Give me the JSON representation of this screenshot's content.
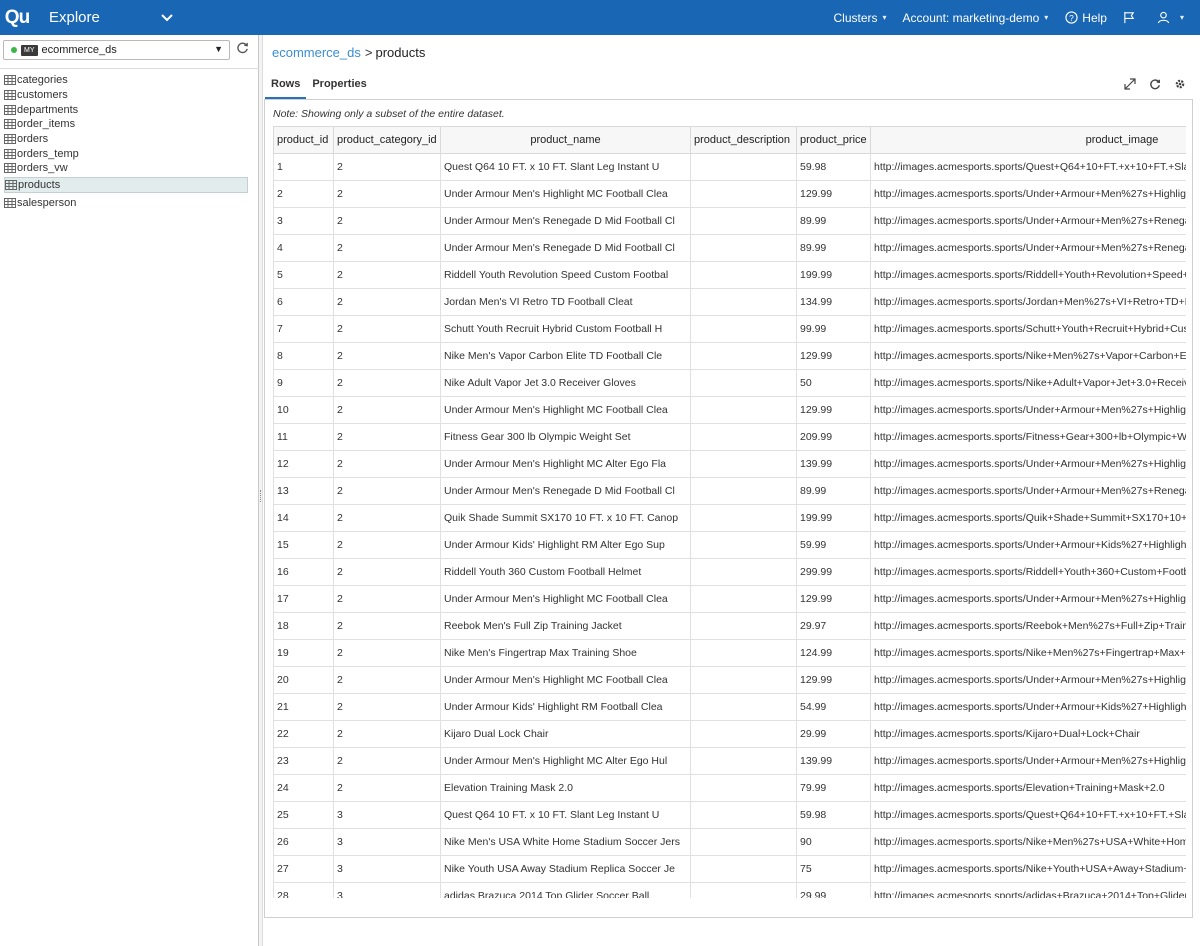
{
  "app": {
    "logo": "Qu",
    "title": "Explore",
    "clusters_label": "Clusters",
    "account_label": "Account: marketing-demo",
    "help_label": "Help"
  },
  "sidebar": {
    "datasource": {
      "badge": "MY",
      "name": "ecommerce_ds"
    },
    "tables": [
      {
        "name": "categories"
      },
      {
        "name": "customers"
      },
      {
        "name": "departments"
      },
      {
        "name": "order_items"
      },
      {
        "name": "orders"
      },
      {
        "name": "orders_temp"
      },
      {
        "name": "orders_vw"
      },
      {
        "name": "products",
        "selected": true
      },
      {
        "name": "salesperson"
      }
    ]
  },
  "breadcrumb": {
    "datasource": "ecommerce_ds",
    "separator": ">",
    "table": "products"
  },
  "tabs": [
    {
      "label": "Rows",
      "active": true
    },
    {
      "label": "Properties",
      "active": false
    }
  ],
  "note": "Note: Showing only a subset of the entire dataset.",
  "grid": {
    "columns": [
      "product_id",
      "product_category_id",
      "product_name",
      "product_description",
      "product_price",
      "product_image"
    ],
    "rows": [
      [
        "1",
        "2",
        "Quest Q64 10 FT. x 10 FT. Slant Leg Instant U",
        "",
        "59.98",
        "http://images.acmesports.sports/Quest+Q64+10+FT.+x+10+FT.+Sla"
      ],
      [
        "2",
        "2",
        "Under Armour Men's Highlight MC Football Clea",
        "",
        "129.99",
        "http://images.acmesports.sports/Under+Armour+Men%27s+Highlig"
      ],
      [
        "3",
        "2",
        "Under Armour Men's Renegade D Mid Football Cl",
        "",
        "89.99",
        "http://images.acmesports.sports/Under+Armour+Men%27s+Renega"
      ],
      [
        "4",
        "2",
        "Under Armour Men's Renegade D Mid Football Cl",
        "",
        "89.99",
        "http://images.acmesports.sports/Under+Armour+Men%27s+Renega"
      ],
      [
        "5",
        "2",
        "Riddell Youth Revolution Speed Custom Footbal",
        "",
        "199.99",
        "http://images.acmesports.sports/Riddell+Youth+Revolution+Speed+"
      ],
      [
        "6",
        "2",
        "Jordan Men's VI Retro TD Football Cleat",
        "",
        "134.99",
        "http://images.acmesports.sports/Jordan+Men%27s+VI+Retro+TD+F"
      ],
      [
        "7",
        "2",
        "Schutt Youth Recruit Hybrid Custom Football H",
        "",
        "99.99",
        "http://images.acmesports.sports/Schutt+Youth+Recruit+Hybrid+Cus"
      ],
      [
        "8",
        "2",
        "Nike Men's Vapor Carbon Elite TD Football Cle",
        "",
        "129.99",
        "http://images.acmesports.sports/Nike+Men%27s+Vapor+Carbon+E"
      ],
      [
        "9",
        "2",
        "Nike Adult Vapor Jet 3.0 Receiver Gloves",
        "",
        "50",
        "http://images.acmesports.sports/Nike+Adult+Vapor+Jet+3.0+Receiv"
      ],
      [
        "10",
        "2",
        "Under Armour Men's Highlight MC Football Clea",
        "",
        "129.99",
        "http://images.acmesports.sports/Under+Armour+Men%27s+Highlig"
      ],
      [
        "11",
        "2",
        "Fitness Gear 300 lb Olympic Weight Set",
        "",
        "209.99",
        "http://images.acmesports.sports/Fitness+Gear+300+lb+Olympic+W"
      ],
      [
        "12",
        "2",
        "Under Armour Men's Highlight MC Alter Ego Fla",
        "",
        "139.99",
        "http://images.acmesports.sports/Under+Armour+Men%27s+Highlig"
      ],
      [
        "13",
        "2",
        "Under Armour Men's Renegade D Mid Football Cl",
        "",
        "89.99",
        "http://images.acmesports.sports/Under+Armour+Men%27s+Renega"
      ],
      [
        "14",
        "2",
        "Quik Shade Summit SX170 10 FT. x 10 FT. Canop",
        "",
        "199.99",
        "http://images.acmesports.sports/Quik+Shade+Summit+SX170+10+"
      ],
      [
        "15",
        "2",
        "Under Armour Kids' Highlight RM Alter Ego Sup",
        "",
        "59.99",
        "http://images.acmesports.sports/Under+Armour+Kids%27+Highligh"
      ],
      [
        "16",
        "2",
        "Riddell Youth 360 Custom Football Helmet",
        "",
        "299.99",
        "http://images.acmesports.sports/Riddell+Youth+360+Custom+Footb"
      ],
      [
        "17",
        "2",
        "Under Armour Men's Highlight MC Football Clea",
        "",
        "129.99",
        "http://images.acmesports.sports/Under+Armour+Men%27s+Highlig"
      ],
      [
        "18",
        "2",
        "Reebok Men's Full Zip Training Jacket",
        "",
        "29.97",
        "http://images.acmesports.sports/Reebok+Men%27s+Full+Zip+Train"
      ],
      [
        "19",
        "2",
        "Nike Men's Fingertrap Max Training Shoe",
        "",
        "124.99",
        "http://images.acmesports.sports/Nike+Men%27s+Fingertrap+Max+"
      ],
      [
        "20",
        "2",
        "Under Armour Men's Highlight MC Football Clea",
        "",
        "129.99",
        "http://images.acmesports.sports/Under+Armour+Men%27s+Highlig"
      ],
      [
        "21",
        "2",
        "Under Armour Kids' Highlight RM Football Clea",
        "",
        "54.99",
        "http://images.acmesports.sports/Under+Armour+Kids%27+Highligh"
      ],
      [
        "22",
        "2",
        "Kijaro Dual Lock Chair",
        "",
        "29.99",
        "http://images.acmesports.sports/Kijaro+Dual+Lock+Chair"
      ],
      [
        "23",
        "2",
        "Under Armour Men's Highlight MC Alter Ego Hul",
        "",
        "139.99",
        "http://images.acmesports.sports/Under+Armour+Men%27s+Highlig"
      ],
      [
        "24",
        "2",
        "Elevation Training Mask 2.0",
        "",
        "79.99",
        "http://images.acmesports.sports/Elevation+Training+Mask+2.0"
      ],
      [
        "25",
        "3",
        "Quest Q64 10 FT. x 10 FT. Slant Leg Instant U",
        "",
        "59.98",
        "http://images.acmesports.sports/Quest+Q64+10+FT.+x+10+FT.+Sla"
      ],
      [
        "26",
        "3",
        "Nike Men's USA White Home Stadium Soccer Jers",
        "",
        "90",
        "http://images.acmesports.sports/Nike+Men%27s+USA+White+Hom"
      ],
      [
        "27",
        "3",
        "Nike Youth USA Away Stadium Replica Soccer Je",
        "",
        "75",
        "http://images.acmesports.sports/Nike+Youth+USA+Away+Stadium+"
      ],
      [
        "28",
        "3",
        "adidas Brazuca 2014 Top Glider Soccer Ball",
        "",
        "29.99",
        "http://images.acmesports.sports/adidas+Brazuca+2014+Top+Glider"
      ]
    ]
  },
  "colors": {
    "topbar": "#1866b4",
    "link": "#3b8ed0",
    "status_dot": "#3bb54a",
    "tab_active": "#2a72b8"
  }
}
